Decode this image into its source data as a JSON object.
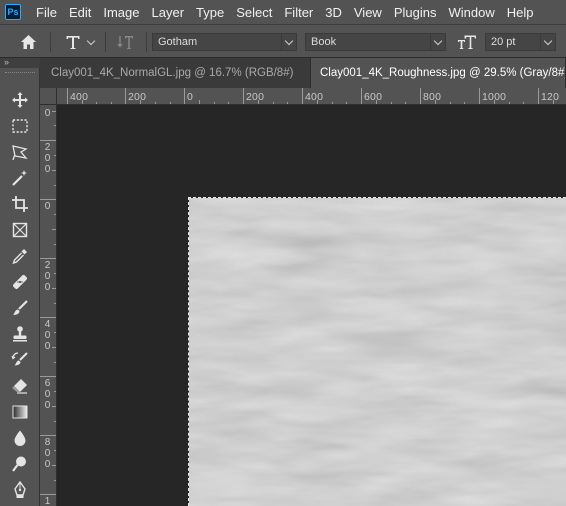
{
  "app": {
    "logo_text": "Ps"
  },
  "menu": [
    "File",
    "Edit",
    "Image",
    "Layer",
    "Type",
    "Select",
    "Filter",
    "3D",
    "View",
    "Plugins",
    "Window",
    "Help"
  ],
  "options_bar": {
    "font_family": "Gotham",
    "font_style": "Book",
    "font_size": "20 pt"
  },
  "tools_collapse_label": "»",
  "tabs": [
    {
      "label": "Clay001_4K_NormalGL.jpg @ 16.7% (RGB/8#)",
      "active": false
    },
    {
      "label": "Clay001_4K_Roughness.jpg @ 29.5% (Gray/8#)",
      "active": true
    }
  ],
  "ruler_h_labels": [
    "400",
    "200",
    "0",
    "200",
    "400",
    "600",
    "800",
    "1000",
    "120"
  ],
  "ruler_v_labels": [
    "0",
    "200",
    "0",
    "200",
    "400",
    "600",
    "800",
    "1"
  ],
  "tools": [
    "move-tool",
    "marquee-tool",
    "lasso-tool",
    "magic-wand-tool",
    "crop-tool",
    "frame-tool",
    "eyedropper-tool",
    "healing-brush-tool",
    "brush-tool",
    "clone-stamp-tool",
    "history-brush-tool",
    "eraser-tool",
    "gradient-tool",
    "blur-tool",
    "dodge-tool",
    "pen-tool"
  ],
  "colors": {
    "panel": "#535353",
    "canvas_bg": "#262626",
    "accent": "#31a8ff"
  }
}
